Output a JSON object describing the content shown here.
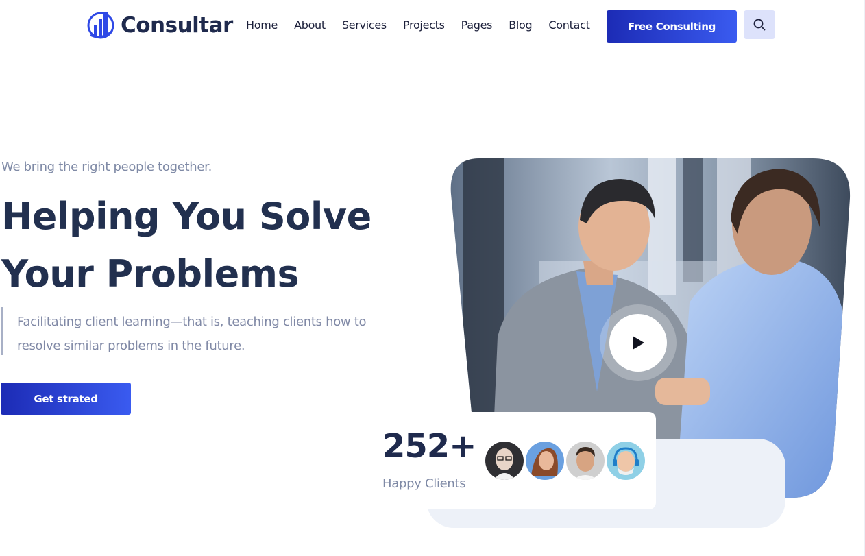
{
  "brand": {
    "name": "Consultar",
    "accent": "#2f49e6"
  },
  "nav": {
    "items": [
      {
        "label": "Home"
      },
      {
        "label": "About"
      },
      {
        "label": "Services"
      },
      {
        "label": "Projects"
      },
      {
        "label": "Pages"
      },
      {
        "label": "Blog"
      },
      {
        "label": "Contact"
      }
    ],
    "cta_label": "Free Consulting",
    "search_icon": "search-icon"
  },
  "hero": {
    "tagline": "We bring the right people together.",
    "headline_line1": "Helping You Solve",
    "headline_line2": "Your Problems",
    "description": "Facilitating client learning—that is, teaching clients how to resolve similar problems in the future.",
    "button_label": "Get strated",
    "play_icon": "play-icon"
  },
  "clients": {
    "count": "252+",
    "label": "Happy Clients",
    "avatars": [
      "avatar-woman-glasses",
      "avatar-woman-laughing",
      "avatar-man-smiling",
      "avatar-man-headphones"
    ]
  }
}
